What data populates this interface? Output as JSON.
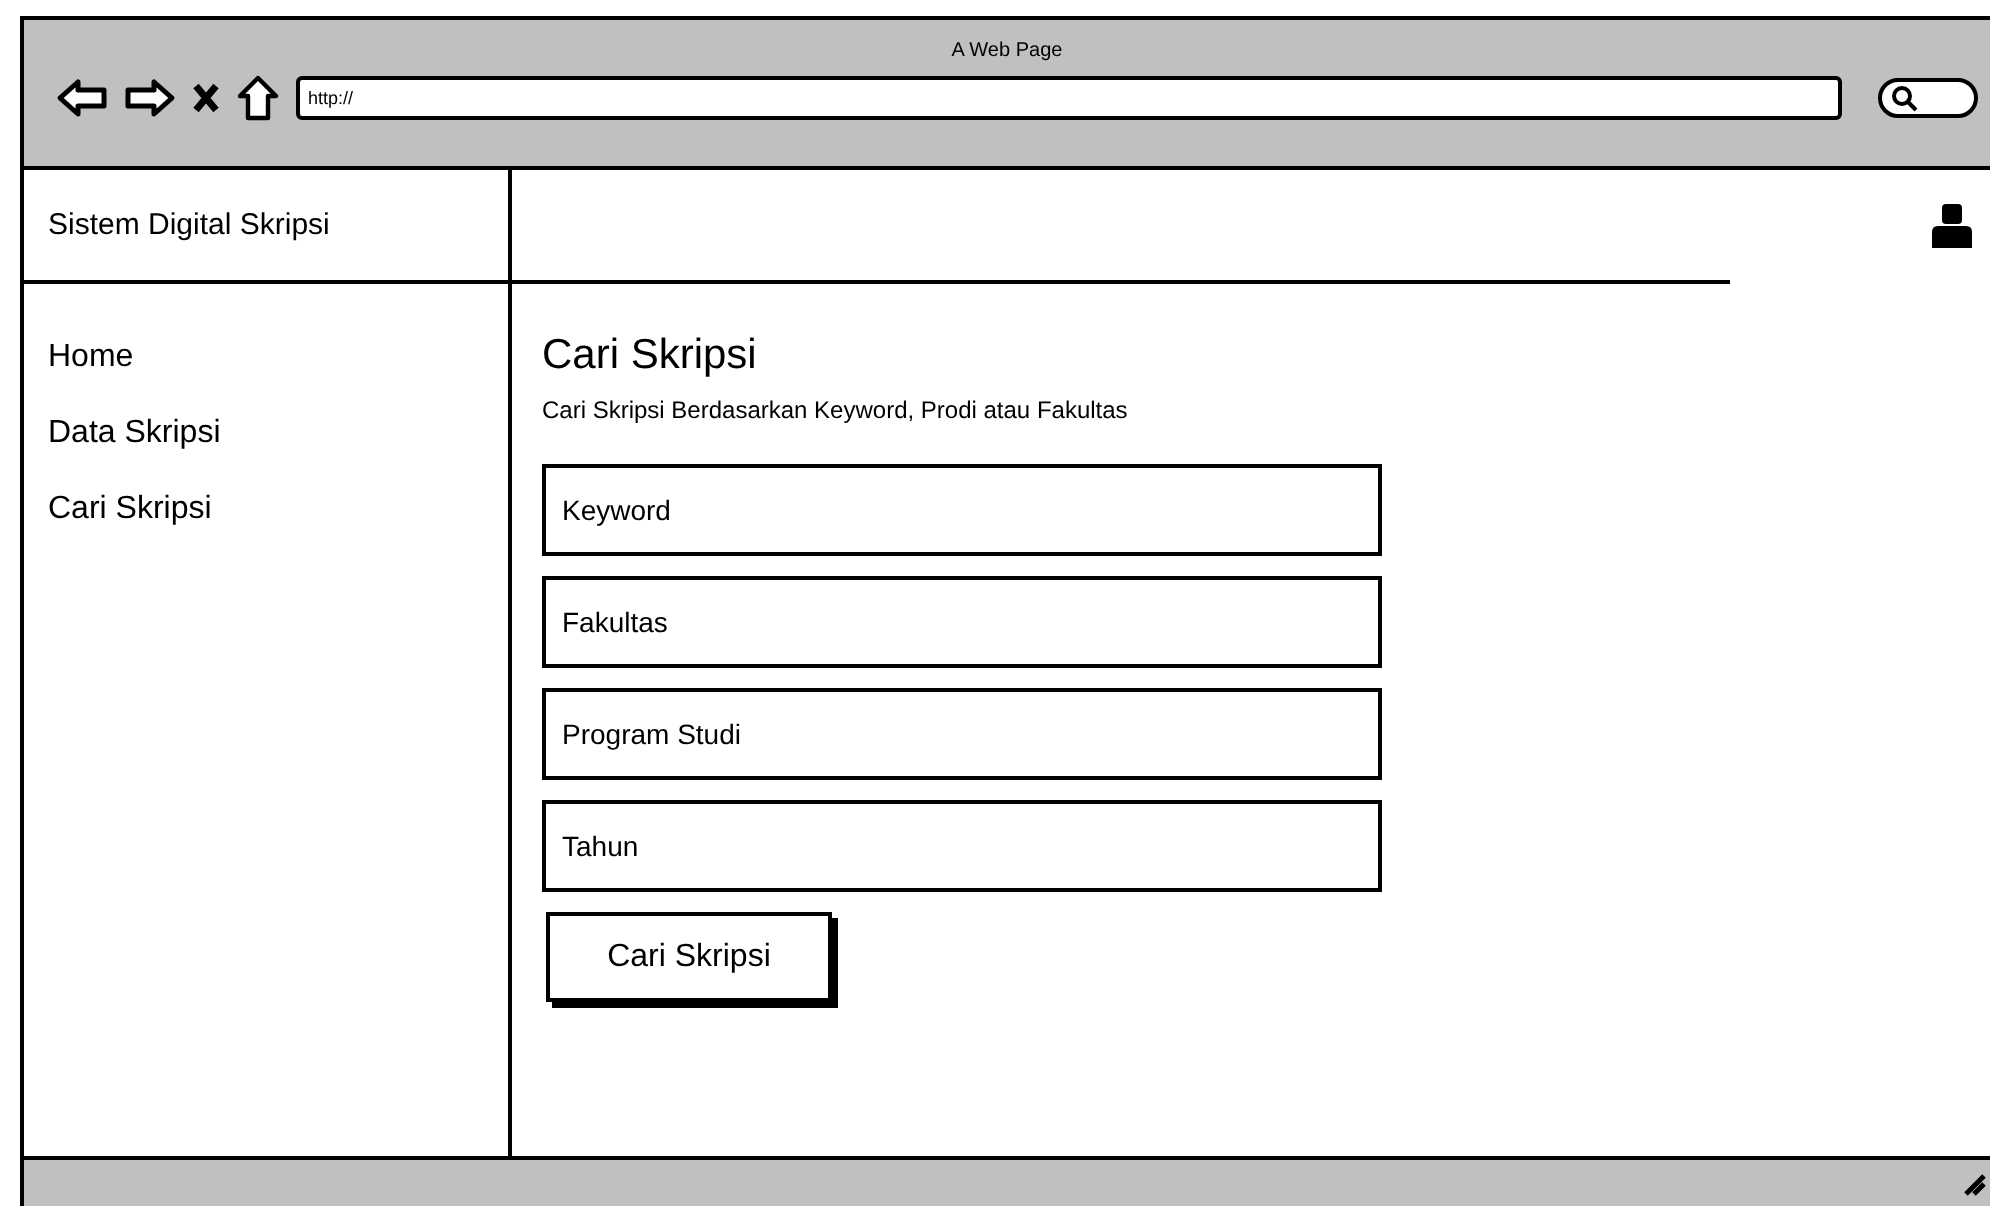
{
  "window": {
    "title": "A Web Page"
  },
  "browser": {
    "url": "http://"
  },
  "sidebar": {
    "title": "Sistem Digital Skripsi",
    "items": [
      {
        "label": "Home"
      },
      {
        "label": "Data Skripsi"
      },
      {
        "label": "Cari Skripsi"
      }
    ]
  },
  "main": {
    "heading": "Cari Skripsi",
    "subtitle": "Cari Skripsi Berdasarkan Keyword, Prodi atau Fakultas",
    "fields": [
      {
        "placeholder": "Keyword"
      },
      {
        "placeholder": "Fakultas"
      },
      {
        "placeholder": "Program Studi"
      },
      {
        "placeholder": "Tahun"
      }
    ],
    "button": "Cari Skripsi"
  }
}
